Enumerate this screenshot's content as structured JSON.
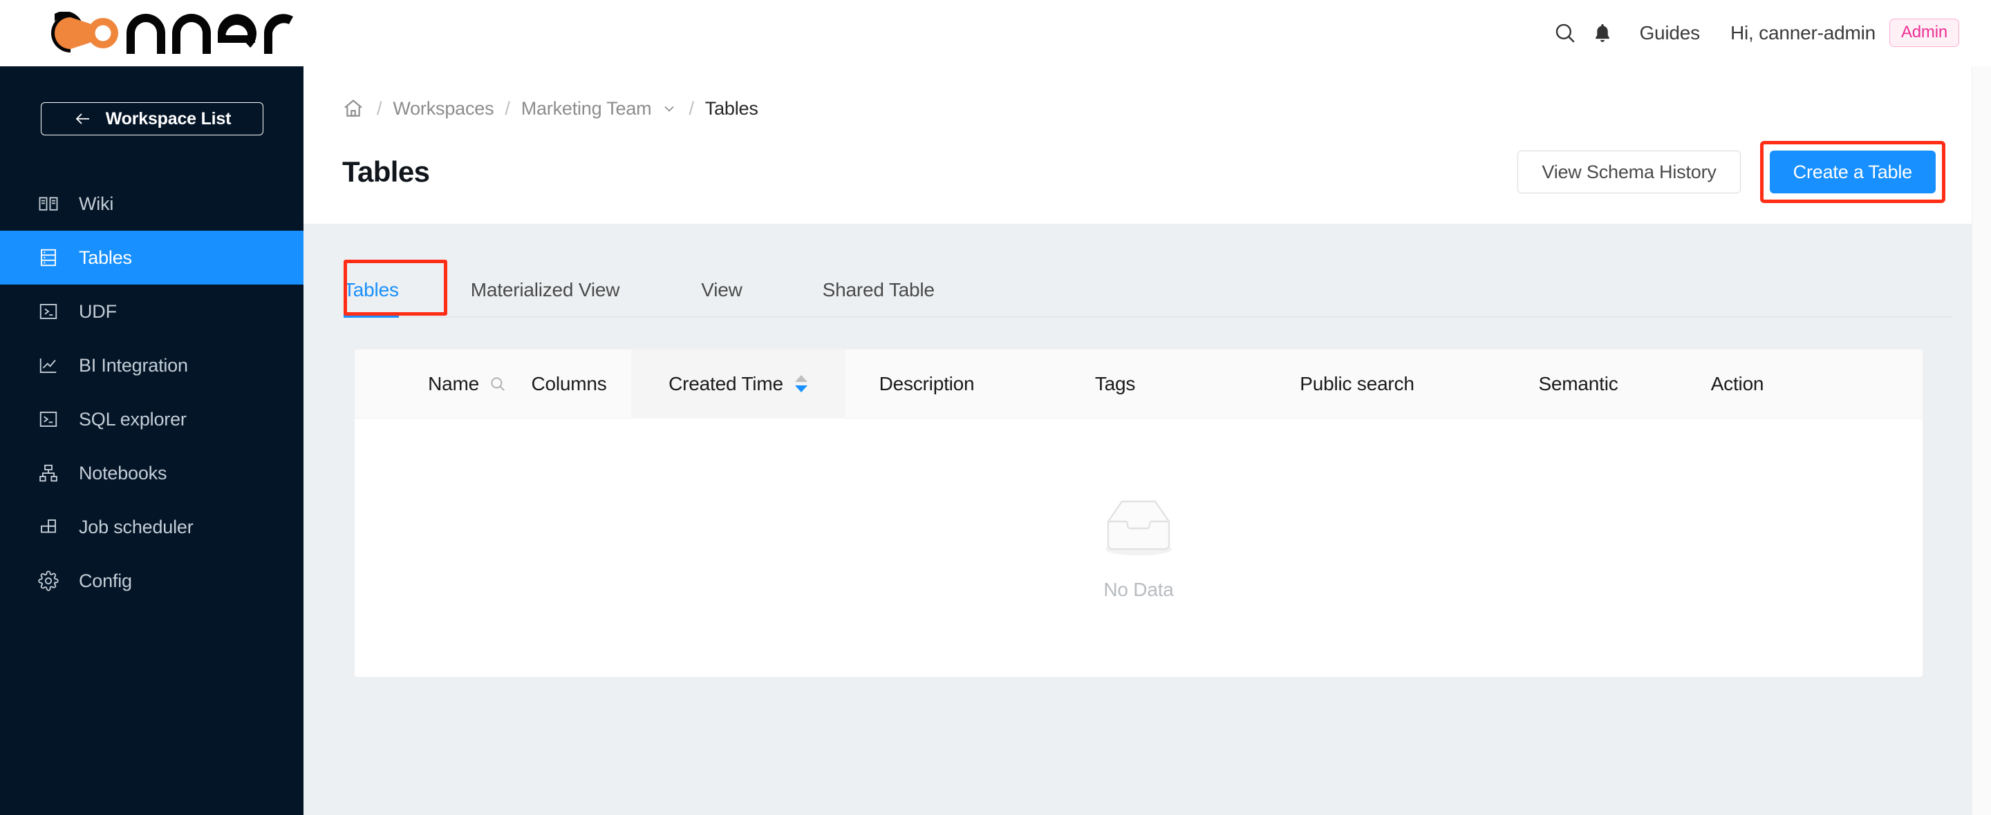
{
  "brand": {
    "name": "canner",
    "accent": "#F0853C"
  },
  "topbar": {
    "search_icon": "search-icon",
    "bell_icon": "bell-icon",
    "guides_label": "Guides",
    "greeting": "Hi, canner-admin",
    "role_badge": "Admin",
    "role_badge_color": "#eb2f96"
  },
  "sidebar": {
    "workspace_button": "Workspace List",
    "back_icon": "arrow-left-icon",
    "active_accent": "#1890ff",
    "items": [
      {
        "label": "Wiki",
        "icon": "book-icon",
        "active": false
      },
      {
        "label": "Tables",
        "icon": "table-icon",
        "active": true
      },
      {
        "label": "UDF",
        "icon": "code-terminal-icon",
        "active": false
      },
      {
        "label": "BI Integration",
        "icon": "line-chart-icon",
        "active": false
      },
      {
        "label": "SQL explorer",
        "icon": "console-icon",
        "active": false
      },
      {
        "label": "Notebooks",
        "icon": "sitemap-icon",
        "active": false
      },
      {
        "label": "Job scheduler",
        "icon": "blocks-icon",
        "active": false
      },
      {
        "label": "Config",
        "icon": "gear-icon",
        "active": false
      }
    ]
  },
  "breadcrumb": {
    "home_icon": "home-icon",
    "separator": "/",
    "items": [
      {
        "label": "Workspaces",
        "current": false,
        "caret": false
      },
      {
        "label": "Marketing Team",
        "current": false,
        "caret": true
      },
      {
        "label": "Tables",
        "current": true,
        "caret": false
      }
    ]
  },
  "page": {
    "title": "Tables",
    "secondary_button": "View Schema History",
    "primary_button": "Create a Table",
    "primary_button_color": "#1890ff",
    "highlight_color": "#ff2d16"
  },
  "tabs": {
    "items": [
      {
        "label": "Tables",
        "active": true,
        "highlighted": true
      },
      {
        "label": "Materialized View",
        "active": false,
        "highlighted": false
      },
      {
        "label": "View",
        "active": false,
        "highlighted": false
      },
      {
        "label": "Shared Table",
        "active": false,
        "highlighted": false
      }
    ]
  },
  "table": {
    "columns": [
      {
        "label": "Name",
        "has_search": true,
        "sortable": false
      },
      {
        "label": "Columns",
        "has_search": false,
        "sortable": false
      },
      {
        "label": "Created Time",
        "has_search": false,
        "sortable": true,
        "sort_direction": "descend"
      },
      {
        "label": "Description",
        "has_search": false,
        "sortable": false
      },
      {
        "label": "Tags",
        "has_search": false,
        "sortable": false
      },
      {
        "label": "Public search",
        "has_search": false,
        "sortable": false
      },
      {
        "label": "Semantic",
        "has_search": false,
        "sortable": false
      },
      {
        "label": "Action",
        "has_search": false,
        "sortable": false
      }
    ],
    "rows": [],
    "empty_icon": "empty-inbox-icon",
    "empty_text": "No Data"
  }
}
